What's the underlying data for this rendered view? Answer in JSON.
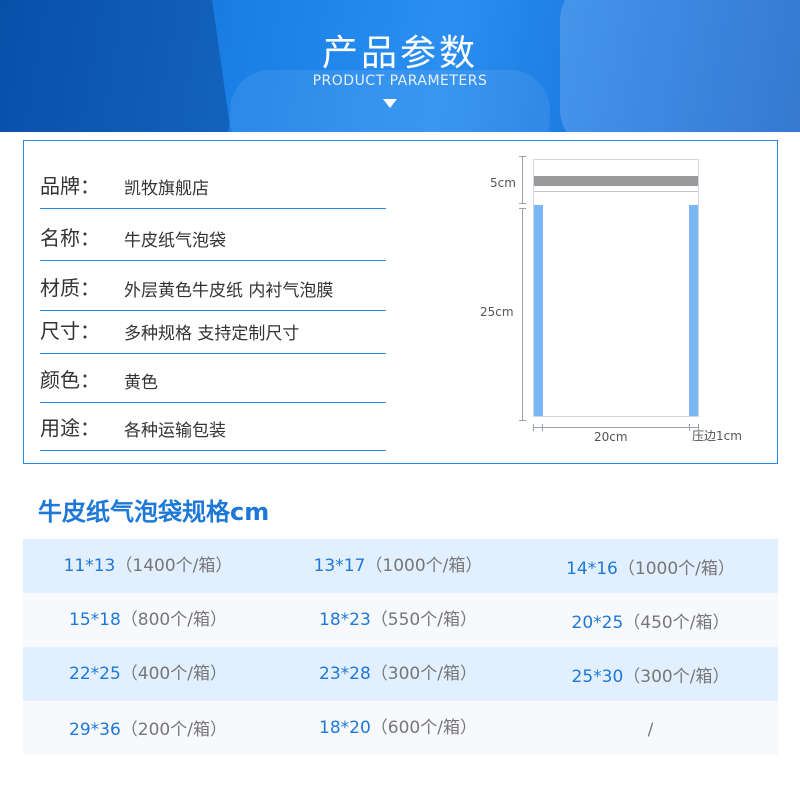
{
  "header": {
    "title": "产品参数",
    "subtitle": "PRODUCT PARAMETERS"
  },
  "params": [
    {
      "label": "品牌：",
      "value": "凯牧旗舰店"
    },
    {
      "label": "名称：",
      "value": "牛皮纸气泡袋"
    },
    {
      "label": "材质：",
      "value": "外层黄色牛皮纸 内衬气泡膜"
    },
    {
      "label": "尺寸：",
      "value": "多种规格 支持定制尺寸"
    },
    {
      "label": "颜色：",
      "value": "黄色"
    },
    {
      "label": "用途：",
      "value": "各种运输包装"
    }
  ],
  "diagram": {
    "flap_label": "5cm",
    "height_label": "25cm",
    "width_label": "20cm",
    "edge_label": "压边1cm"
  },
  "spec_title": "牛皮纸气泡袋规格cm",
  "specs": [
    [
      {
        "size": "11*13",
        "qty": "（1400个/箱）"
      },
      {
        "size": "13*17",
        "qty": "（1000个/箱）"
      },
      {
        "size": "14*16",
        "qty": "（1000个/箱）"
      }
    ],
    [
      {
        "size": "15*18",
        "qty": "（800个/箱）"
      },
      {
        "size": "18*23",
        "qty": "（550个/箱）"
      },
      {
        "size": "20*25",
        "qty": "（450个/箱）"
      }
    ],
    [
      {
        "size": "22*25",
        "qty": "（400个/箱）"
      },
      {
        "size": "23*28",
        "qty": "（300个/箱）"
      },
      {
        "size": "25*30",
        "qty": "（300个/箱）"
      }
    ],
    [
      {
        "size": "29*36",
        "qty": "（200个/箱）"
      },
      {
        "size": "18*20",
        "qty": "（600个/箱）"
      },
      {
        "size": "/",
        "qty": ""
      }
    ]
  ],
  "colors": {
    "accent": "#1e78d8",
    "border": "#2a86e8",
    "row_alt": "#e2efff",
    "strip": "#7ab8f5"
  }
}
